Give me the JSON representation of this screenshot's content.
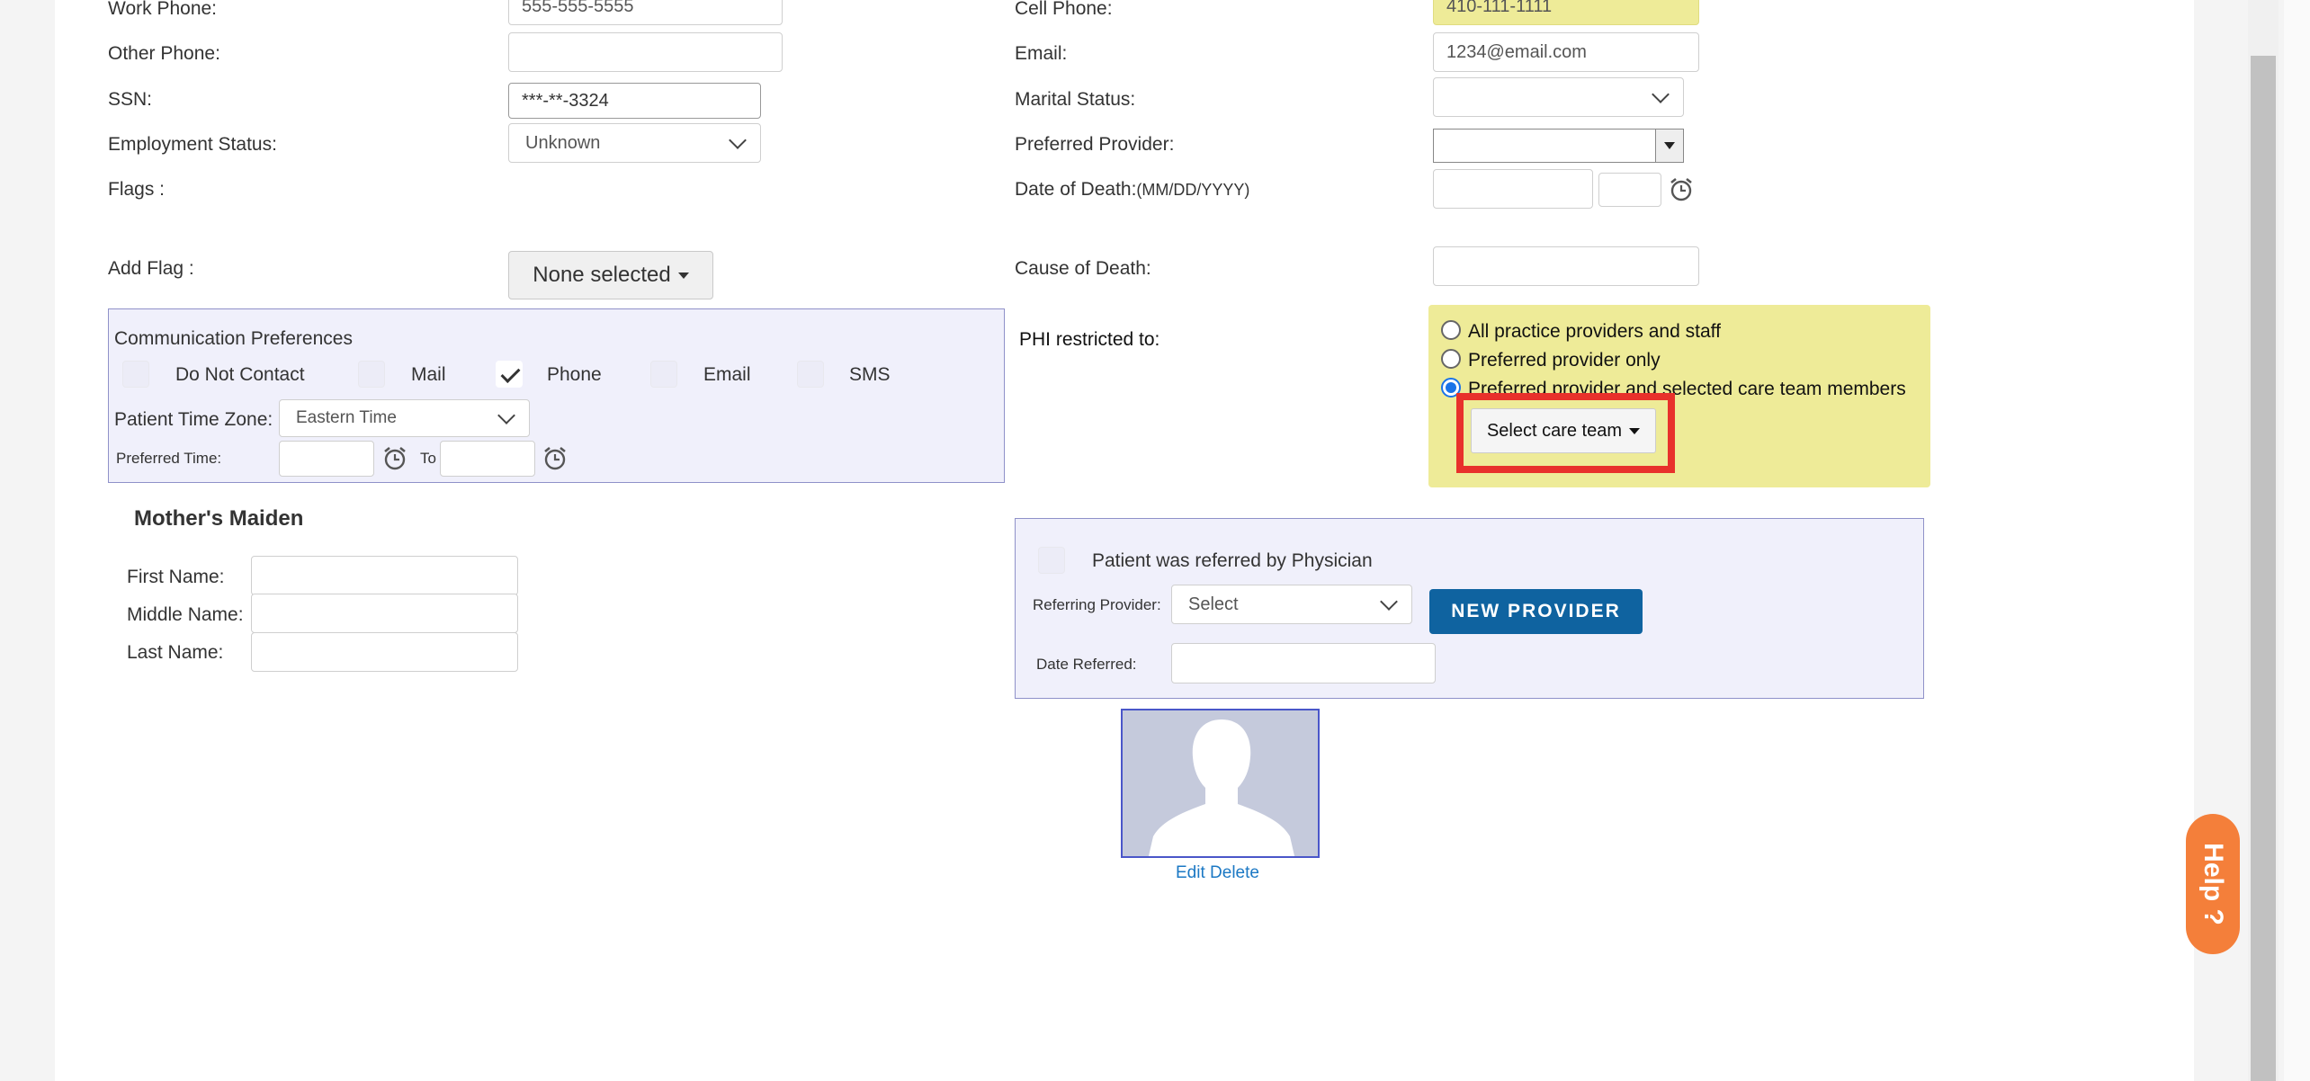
{
  "colors": {
    "yellow_highlight": "#eeeb98",
    "blue_panel": "#f0f0fb",
    "blue_border": "#8f91c9",
    "primary_button": "#0f63a0",
    "help_orange": "#f47f3a",
    "red_box": "#e8312b",
    "link": "#1b78c4"
  },
  "left": {
    "work_phone_label": "Work Phone:",
    "work_phone_value": "555-555-5555",
    "other_phone_label": "Other Phone:",
    "other_phone_value": "",
    "ssn_label": "SSN:",
    "ssn_value": "***-**-3324",
    "employment_label": "Employment Status:",
    "employment_value": "Unknown",
    "flags_label": "Flags :",
    "add_flag_label": "Add Flag :",
    "add_flag_button": "None selected"
  },
  "comm": {
    "title": "Communication Preferences",
    "options": [
      {
        "label": "Do Not Contact",
        "checked": false
      },
      {
        "label": "Mail",
        "checked": false
      },
      {
        "label": "Phone",
        "checked": true
      },
      {
        "label": "Email",
        "checked": false
      },
      {
        "label": "SMS",
        "checked": false
      }
    ],
    "timezone_label": "Patient Time Zone:",
    "timezone_value": "Eastern Time",
    "preferred_time_label": "Preferred Time:",
    "to_label": "To",
    "time_from": "",
    "time_to": ""
  },
  "maiden": {
    "title": "Mother's Maiden",
    "first_label": "First Name:",
    "middle_label": "Middle Name:",
    "last_label": "Last Name:",
    "first_value": "",
    "middle_value": "",
    "last_value": ""
  },
  "right": {
    "cell_phone_label": "Cell Phone:",
    "cell_phone_value": "410-111-1111",
    "email_label": "Email:",
    "email_value": "1234@email.com",
    "marital_label": "Marital Status:",
    "marital_value": "",
    "provider_label": "Preferred Provider:",
    "provider_value": "",
    "dod_label": "Date of Death:",
    "dod_format": "(MM/DD/YYYY)",
    "dod_value": "",
    "dod_time": "",
    "cause_label": "Cause of Death:",
    "cause_value": "",
    "phi_label": "PHI restricted to:",
    "phi_options": [
      {
        "label": "All practice providers and staff",
        "selected": false
      },
      {
        "label": "Preferred provider only",
        "selected": false
      },
      {
        "label": "Preferred provider and selected care team members",
        "selected": true
      }
    ],
    "care_team_button": "Select care team"
  },
  "referral": {
    "referred_label": "Patient was referred by Physician",
    "referred_checked": false,
    "referring_label": "Referring Provider:",
    "referring_value": "Select",
    "new_provider_button": "NEW PROVIDER",
    "date_label": "Date Referred:",
    "date_value": ""
  },
  "photo": {
    "edit": "Edit",
    "delete": "Delete"
  },
  "help": {
    "label": "Help",
    "glyph": "?"
  }
}
